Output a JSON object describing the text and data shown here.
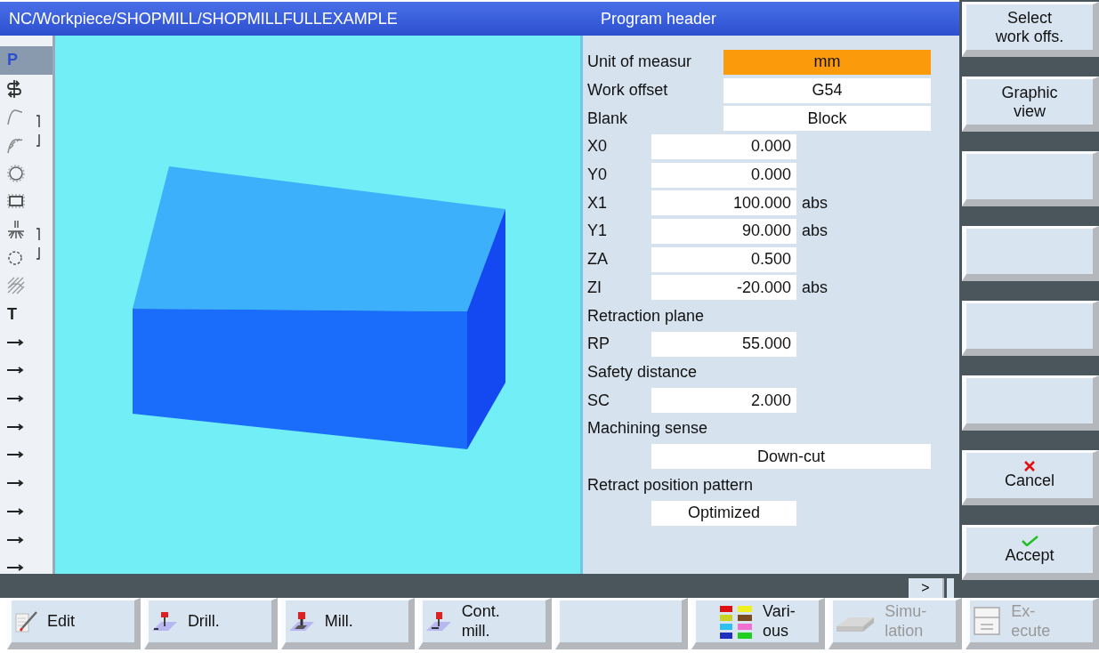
{
  "title_bar": {
    "path": "NC/Workpiece/SHOPMILL/SHOPMILLFULLEXAMPLE",
    "panel_title": "Program header"
  },
  "strip": {
    "items": [
      {
        "kind": "letter",
        "text": "P",
        "selected": true
      },
      {
        "kind": "icon",
        "selected": false
      },
      {
        "kind": "icon",
        "selected": false,
        "bracket_top": true
      },
      {
        "kind": "icon",
        "selected": false,
        "bracket_bottom": true
      },
      {
        "kind": "icon",
        "selected": false
      },
      {
        "kind": "icon",
        "selected": false
      },
      {
        "kind": "icon",
        "selected": false,
        "bracket_top": true
      },
      {
        "kind": "icon",
        "selected": false,
        "bracket_bottom": true
      },
      {
        "kind": "icon",
        "selected": false
      },
      {
        "kind": "letter",
        "text": "T",
        "selected": false
      },
      {
        "kind": "arrow",
        "selected": false
      },
      {
        "kind": "arrow",
        "selected": false
      },
      {
        "kind": "arrow",
        "selected": false
      },
      {
        "kind": "arrow",
        "selected": false
      },
      {
        "kind": "arrow",
        "selected": false
      },
      {
        "kind": "arrow",
        "selected": false
      },
      {
        "kind": "arrow",
        "selected": false
      },
      {
        "kind": "arrow",
        "selected": false
      },
      {
        "kind": "arrow",
        "selected": false
      }
    ]
  },
  "graphic": {
    "kind": "block"
  },
  "form": {
    "rows": [
      {
        "kind": "select",
        "label": "Unit of measur",
        "value": "mm",
        "focused": true
      },
      {
        "kind": "select",
        "label": "Work offset",
        "value": "G54",
        "focused": false
      },
      {
        "kind": "select",
        "label": "Blank",
        "value": "Block",
        "focused": false
      },
      {
        "kind": "number",
        "label": "X0",
        "value": "0.000",
        "focused": false
      },
      {
        "kind": "number",
        "label": "Y0",
        "value": "0.000",
        "focused": false
      },
      {
        "kind": "number",
        "label": "X1",
        "value": "100.000",
        "unit": "abs",
        "focused": false
      },
      {
        "kind": "number",
        "label": "Y1",
        "value": "90.000",
        "unit": "abs",
        "focused": false
      },
      {
        "kind": "number",
        "label": "ZA",
        "value": "0.500",
        "focused": false
      },
      {
        "kind": "number",
        "label": "ZI",
        "value": "-20.000",
        "unit": "abs",
        "focused": false
      },
      {
        "kind": "heading",
        "label": "Retraction plane"
      },
      {
        "kind": "number",
        "label": "RP",
        "value": "55.000",
        "focused": false
      },
      {
        "kind": "heading",
        "label": "Safety distance"
      },
      {
        "kind": "number",
        "label": "SC",
        "value": "2.000",
        "focused": false
      },
      {
        "kind": "heading",
        "label": "Machining sense"
      },
      {
        "kind": "select-wide",
        "value": "Down-cut",
        "focused": false
      },
      {
        "kind": "heading",
        "label": "Retract position pattern"
      },
      {
        "kind": "select-narrow",
        "value": "Optimized",
        "focused": false
      }
    ]
  },
  "status_bar": {
    "scroll_button": ">"
  },
  "vertical_softkeys": [
    {
      "kind": "text",
      "label": "Select\nwork offs."
    },
    {
      "kind": "text",
      "label": "Graphic\nview"
    },
    {
      "kind": "blank"
    },
    {
      "kind": "blank"
    },
    {
      "kind": "blank"
    },
    {
      "kind": "blank"
    },
    {
      "kind": "cancel",
      "label": "Cancel"
    },
    {
      "kind": "accept",
      "label": "Accept"
    }
  ],
  "horizontal_softkeys": [
    {
      "kind": "edit",
      "label": "Edit",
      "disabled": false
    },
    {
      "kind": "drill",
      "label": "Drill.",
      "disabled": false
    },
    {
      "kind": "mill",
      "label": "Mill.",
      "disabled": false
    },
    {
      "kind": "contour",
      "label": "Cont.\nmill.",
      "disabled": false
    },
    {
      "kind": "blank"
    },
    {
      "kind": "various",
      "label": "Vari-\nous",
      "disabled": false
    },
    {
      "kind": "simulation",
      "label": "Simu-\nlation",
      "disabled": true
    },
    {
      "kind": "execute",
      "label": "Ex-\necute",
      "disabled": true
    }
  ]
}
